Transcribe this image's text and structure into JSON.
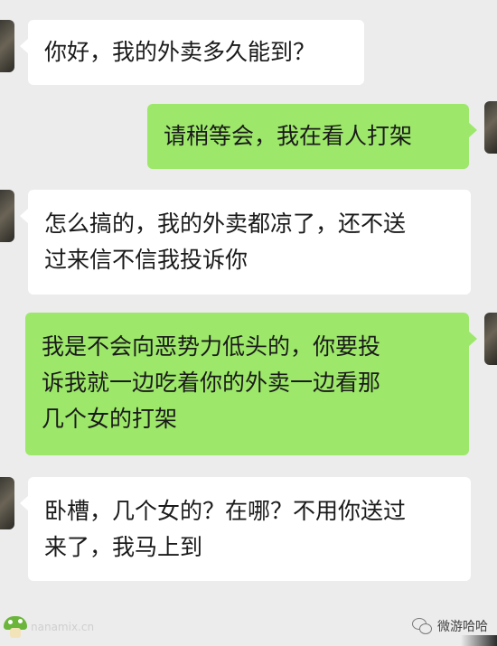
{
  "messages": [
    {
      "side": "left",
      "lines": [
        "你好，我的外卖多久能到？"
      ]
    },
    {
      "side": "right",
      "lines": [
        "请稍等会，我在看人打架"
      ]
    },
    {
      "side": "left",
      "lines": [
        "怎么搞的，我的外卖都凉了，还不送",
        "过来信不信我投诉你"
      ]
    },
    {
      "side": "right",
      "lines": [
        "我是不会向恶势力低头的，你要投",
        "诉我就一边吃着你的外卖一边看那",
        "几个女的打架"
      ]
    },
    {
      "side": "left",
      "lines": [
        "卧槽，几个女的？在哪？不用你送过",
        "来了，我马上到"
      ]
    }
  ],
  "watermark_left": "nanamix.cn",
  "watermark_right": "微游哈哈",
  "colors": {
    "background": "#ececec",
    "bubble_incoming": "#ffffff",
    "bubble_outgoing": "#9de86a",
    "text": "#1a1a1a"
  }
}
